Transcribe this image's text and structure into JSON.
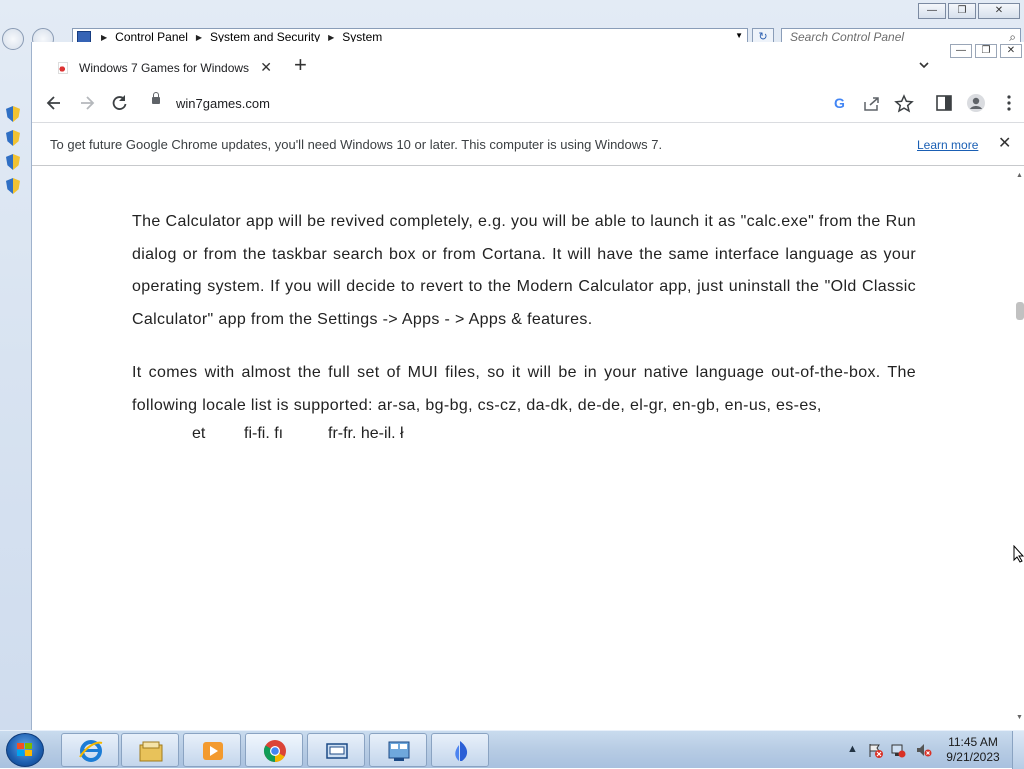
{
  "control_panel": {
    "breadcrumbs": [
      "Control Panel",
      "System and Security",
      "System"
    ],
    "search_placeholder": "Search Control Panel",
    "window_buttons": [
      "minimize",
      "maximize",
      "close"
    ]
  },
  "chrome": {
    "tab": {
      "title": "Windows 7 Games for Windows",
      "close": "✕"
    },
    "new_tab": "+",
    "tab_search": "⌄",
    "url": "win7games.com",
    "infobar": {
      "message": "To get future Google Chrome updates, you'll need Windows 10 or later. This computer is using Windows 7.",
      "learn_more": "Learn more",
      "close": "✕"
    },
    "toolbar_icons": [
      "back-icon",
      "forward-icon",
      "reload-icon",
      "google-icon",
      "share-icon",
      "bookmark-star-icon",
      "side-panel-icon",
      "profile-icon",
      "menu-icon"
    ]
  },
  "article": {
    "paragraph1": "The Calculator app will be revived completely, e.g. you will be able to launch it as \"calc.exe\" from the Run dialog or from the taskbar search box or from Cortana. It will have the same interface language as your operating system. If you will decide to revert to the Modern Calculator app, just uninstall the \"Old Classic Calculator\" app from the Settings -> Apps - > Apps & features.",
    "paragraph2": "It comes with almost the full set of MUI files, so it will be in your native language out-of-the-box. The following locale list is supported: ar-sa, bg-bg, cs-cz, da-dk, de-de, el-gr, en-gb, en-us, es-es,",
    "partial_line": [
      "et",
      "fi-fi. fı",
      "fr-fr. he-il. ł"
    ]
  },
  "taskbar": {
    "apps": [
      "internet-explorer",
      "windows-explorer",
      "media-player",
      "google-chrome",
      "app-window",
      "control-panel",
      "sailboat-app"
    ],
    "time": "11:45 AM",
    "date": "9/21/2023"
  },
  "colors": {
    "link": "#1a5fb4",
    "taskbar": "#b7cce4"
  }
}
